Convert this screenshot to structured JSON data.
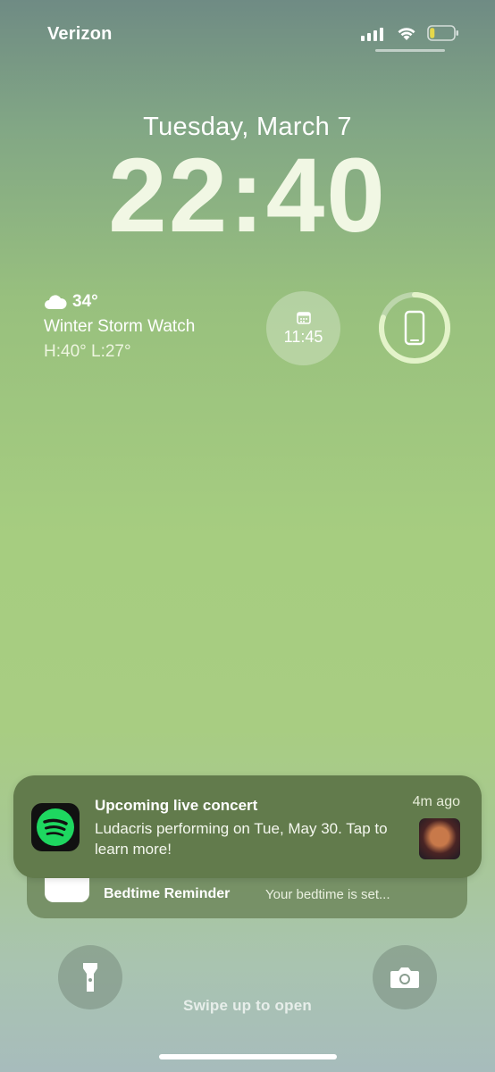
{
  "status_bar": {
    "carrier": "Verizon",
    "icons": [
      "signal-icon",
      "wifi-icon",
      "battery-icon"
    ],
    "battery_level": 0.2,
    "battery_color": "#e6d84a"
  },
  "lock_screen": {
    "date": "Tuesday, March 7",
    "time": "22:40"
  },
  "widgets": {
    "weather": {
      "icon": "cloud-icon",
      "temperature": "34°",
      "condition": "Winter Storm Watch",
      "high_low": "H:40° L:27°"
    },
    "alarm": {
      "icon": "calendar-icon",
      "time": "11:45"
    },
    "battery": {
      "icon": "phone-icon",
      "level": 0.8
    }
  },
  "notifications": [
    {
      "app": "Spotify",
      "icon": "spotify-icon",
      "title": "Upcoming live concert",
      "time": "4m ago",
      "body": "Ludacris performing on Tue, May 30. Tap to learn more!"
    },
    {
      "app": "Health",
      "icon": "health-icon",
      "title": "Bedtime Reminder",
      "body": "Your bedtime is set..."
    }
  ],
  "bottom": {
    "flashlight_icon": "flashlight-icon",
    "camera_icon": "camera-icon",
    "swipe_text": "Swipe up to open"
  }
}
